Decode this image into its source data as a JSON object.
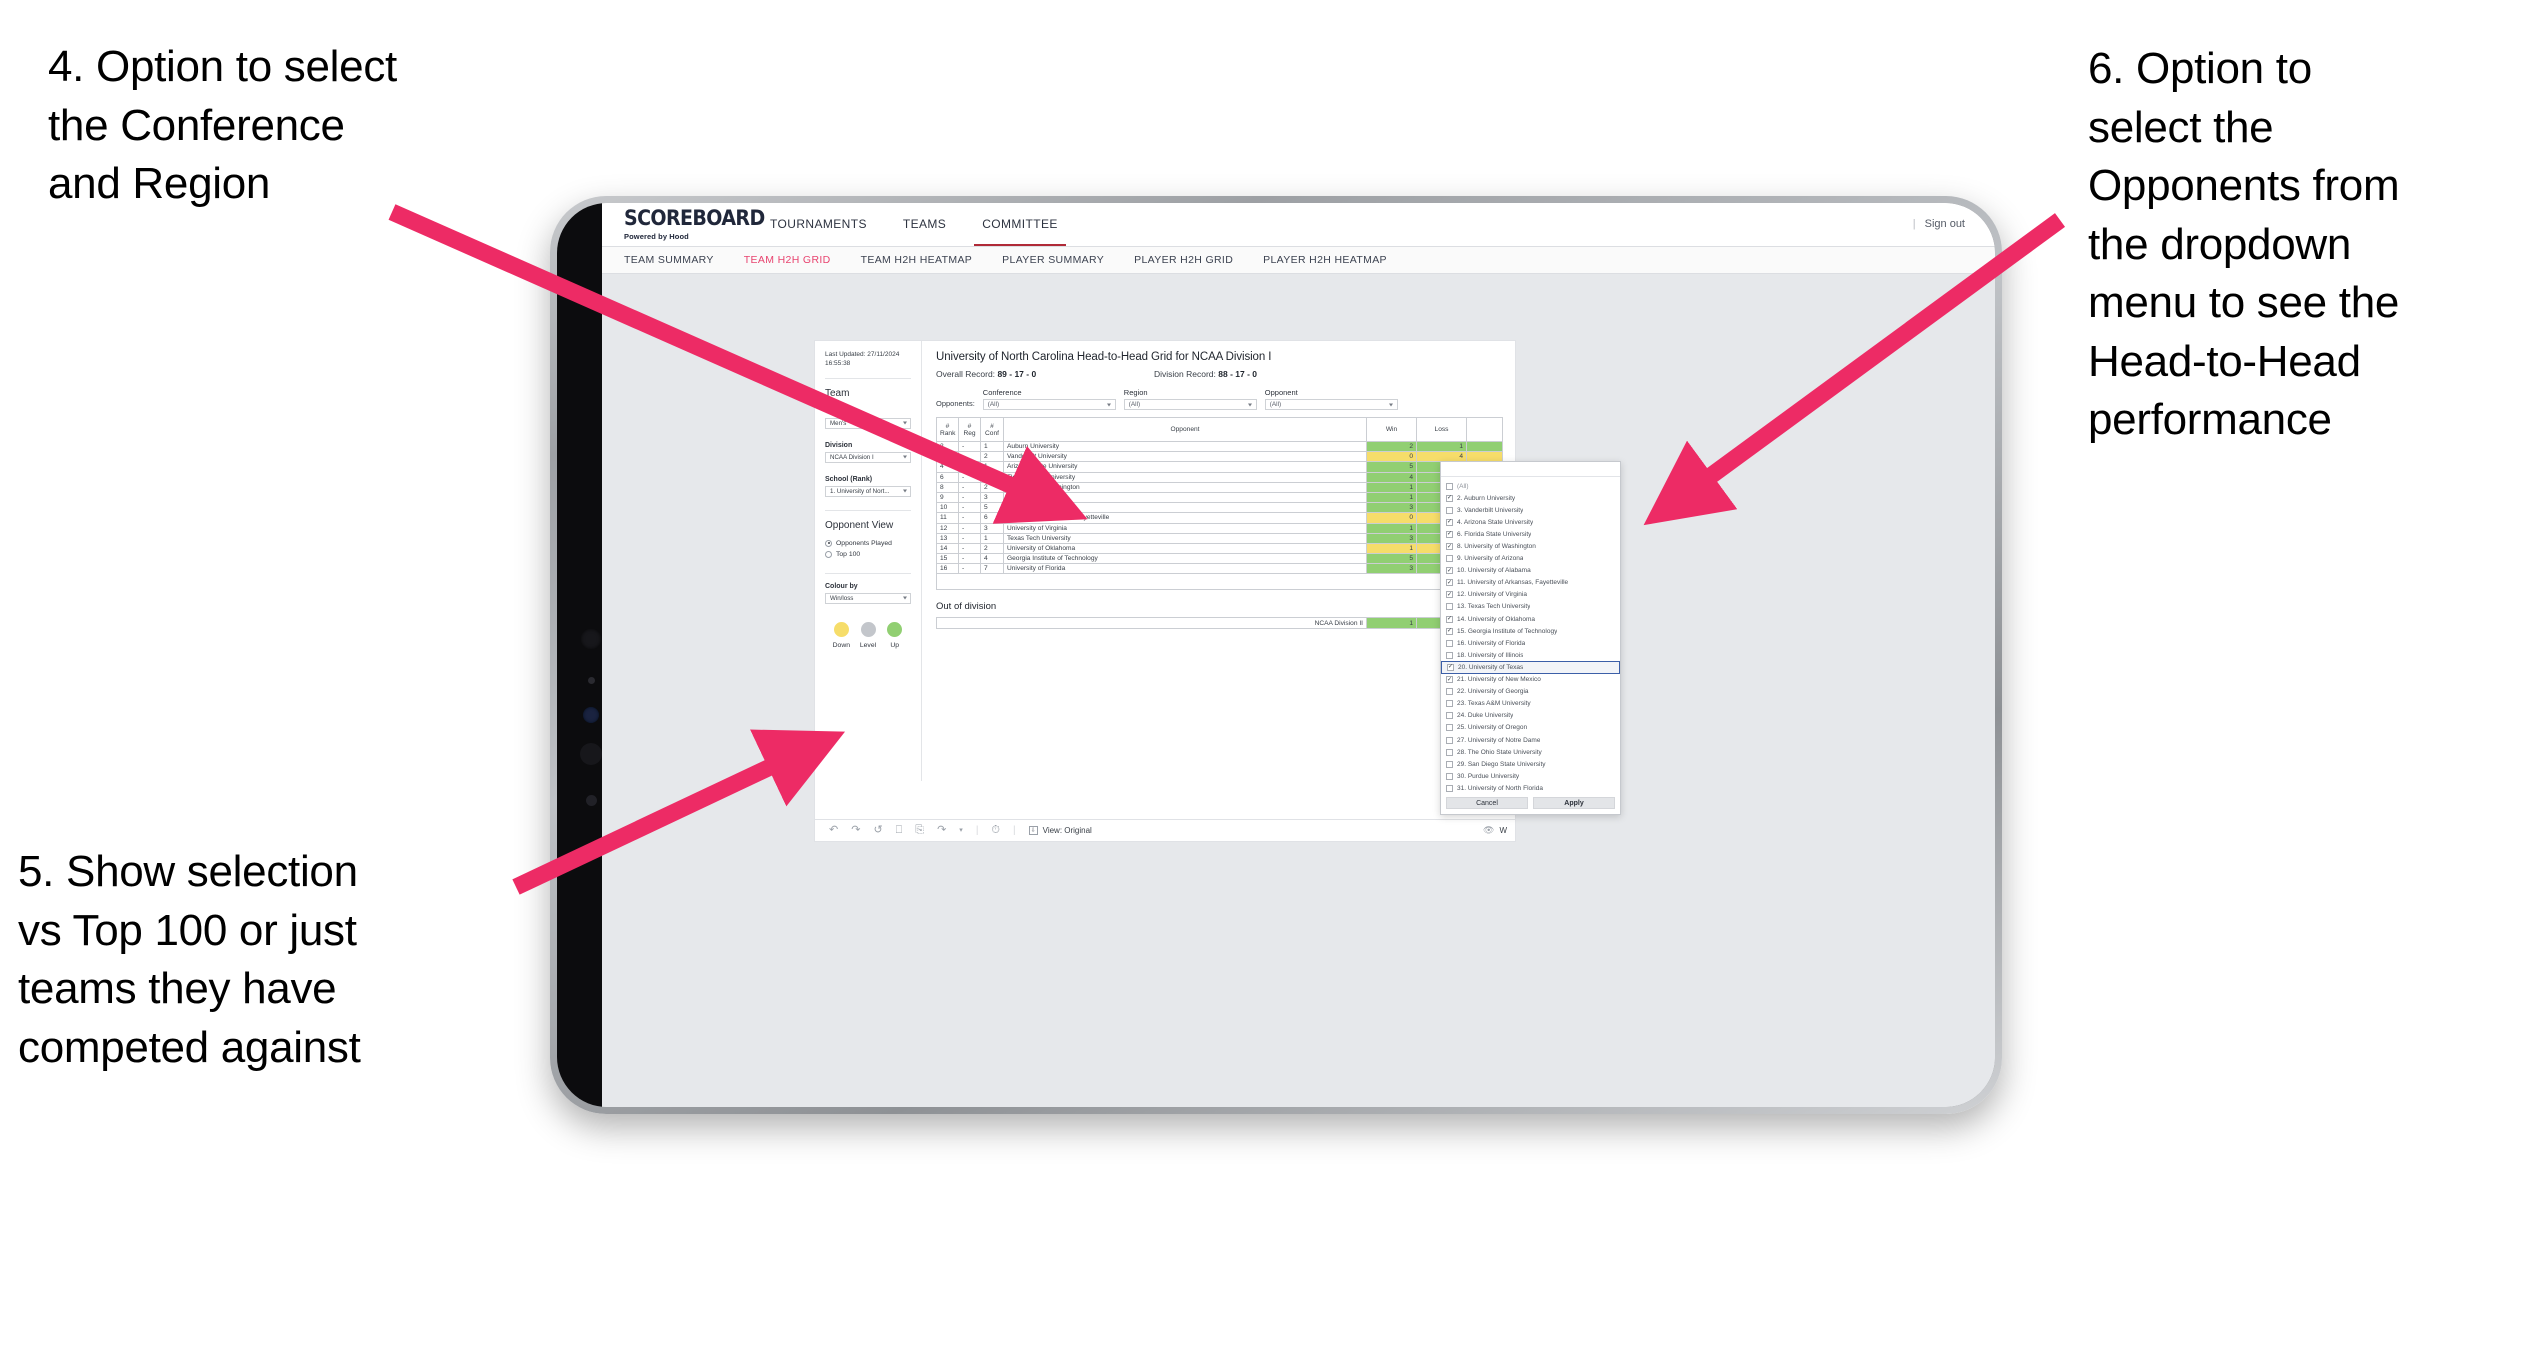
{
  "annotations": [
    {
      "id": "a4",
      "text": "4. Option to select\nthe Conference\nand Region"
    },
    {
      "id": "a5",
      "text": "5. Show selection\nvs Top 100 or just\nteams they have\ncompeted against"
    },
    {
      "id": "a6",
      "text": "6. Option to\nselect the\nOpponents from\nthe dropdown\nmenu to see the\nHead-to-Head\nperformance"
    }
  ],
  "colors": {
    "arrow": "#ED2B65",
    "accent_red": "#b02a37",
    "accent_pink": "#e8436f",
    "up_green": "#91cf72",
    "down_yellow": "#f6dd6a",
    "level_grey": "#c3c6cb"
  },
  "app": {
    "logo": {
      "main": "SCOREBOARD",
      "sub": "Powered by Hood"
    },
    "topnav": [
      {
        "label": "TOURNAMENTS",
        "active": false
      },
      {
        "label": "TEAMS",
        "active": false
      },
      {
        "label": "COMMITTEE",
        "active": true
      }
    ],
    "signout": {
      "divider": "|",
      "label": "Sign out"
    },
    "subnav": [
      {
        "label": "TEAM SUMMARY",
        "active": false
      },
      {
        "label": "TEAM H2H GRID",
        "active": true
      },
      {
        "label": "TEAM H2H HEATMAP",
        "active": false
      },
      {
        "label": "PLAYER SUMMARY",
        "active": false
      },
      {
        "label": "PLAYER H2H GRID",
        "active": false
      },
      {
        "label": "PLAYER H2H HEATMAP",
        "active": false
      }
    ]
  },
  "left_panel": {
    "last_updated": "Last Updated: 27/11/2024 16:55:38",
    "team_heading": "Team",
    "fields": [
      {
        "label": "Gender",
        "value": "Men's"
      },
      {
        "label": "Division",
        "value": "NCAA Division I"
      },
      {
        "label": "School (Rank)",
        "value": "1. University of Nort..."
      }
    ],
    "opponent_view": {
      "heading": "Opponent View",
      "options": [
        {
          "label": "Opponents Played",
          "selected": true
        },
        {
          "label": "Top 100",
          "selected": false
        }
      ]
    },
    "colour_by": {
      "label": "Colour by",
      "value": "Win/loss"
    },
    "legend": [
      {
        "label": "Down",
        "color": "#f6dd6a"
      },
      {
        "label": "Level",
        "color": "#c3c6cb"
      },
      {
        "label": "Up",
        "color": "#91cf72"
      }
    ]
  },
  "viz": {
    "title": "University of North Carolina Head-to-Head Grid for NCAA Division I",
    "overall_record_label": "Overall Record:",
    "overall_record_value": "89 - 17 - 0",
    "division_record_label": "Division Record:",
    "division_record_value": "88 - 17 - 0",
    "opponents_label": "Opponents:",
    "filters": [
      {
        "label": "Conference",
        "value": "(All)"
      },
      {
        "label": "Region",
        "value": "(All)"
      },
      {
        "label": "Opponent",
        "value": "(All)"
      }
    ],
    "out_of_division": {
      "title": "Out of division",
      "name": "NCAA Division II",
      "win": "1",
      "loss": "0",
      "state": "up"
    }
  },
  "chart_data": {
    "type": "table",
    "title": "University of North Carolina Head-to-Head Grid for NCAA Division I",
    "columns": [
      "# Rank",
      "# Reg",
      "# Conf",
      "Opponent",
      "Win",
      "Loss",
      ""
    ],
    "column_headers_split": [
      {
        "l1": "#",
        "l2": "Rank"
      },
      {
        "l1": "#",
        "l2": "Reg"
      },
      {
        "l1": "#",
        "l2": "Conf"
      },
      {
        "l1": "",
        "l2": "Opponent"
      },
      {
        "l1": "",
        "l2": "Win"
      },
      {
        "l1": "",
        "l2": "Loss"
      },
      {
        "l1": "",
        "l2": ""
      }
    ],
    "rows": [
      {
        "rank": "2",
        "reg": "-",
        "conf": "1",
        "opponent": "Auburn University",
        "win": "2",
        "loss": "1",
        "state": "up"
      },
      {
        "rank": "3",
        "reg": "-",
        "conf": "2",
        "opponent": "Vanderbilt University",
        "win": "0",
        "loss": "4",
        "state": "down"
      },
      {
        "rank": "4",
        "reg": "-",
        "conf": "1",
        "opponent": "Arizona State University",
        "win": "5",
        "loss": "1",
        "state": "up"
      },
      {
        "rank": "6",
        "reg": "-",
        "conf": "2",
        "opponent": "Florida State University",
        "win": "4",
        "loss": "2",
        "state": "up"
      },
      {
        "rank": "8",
        "reg": "-",
        "conf": "2",
        "opponent": "University of Washington",
        "win": "1",
        "loss": "0",
        "state": "up"
      },
      {
        "rank": "9",
        "reg": "-",
        "conf": "3",
        "opponent": "University of Arizona",
        "win": "1",
        "loss": "0",
        "state": "up"
      },
      {
        "rank": "10",
        "reg": "-",
        "conf": "5",
        "opponent": "University of Alabama",
        "win": "3",
        "loss": "0",
        "state": "up"
      },
      {
        "rank": "11",
        "reg": "-",
        "conf": "6",
        "opponent": "University of Arkansas, Fayetteville",
        "win": "0",
        "loss": "1",
        "state": "down"
      },
      {
        "rank": "12",
        "reg": "-",
        "conf": "3",
        "opponent": "University of Virginia",
        "win": "1",
        "loss": "0",
        "state": "up"
      },
      {
        "rank": "13",
        "reg": "-",
        "conf": "1",
        "opponent": "Texas Tech University",
        "win": "3",
        "loss": "0",
        "state": "up"
      },
      {
        "rank": "14",
        "reg": "-",
        "conf": "2",
        "opponent": "University of Oklahoma",
        "win": "1",
        "loss": "2",
        "state": "down"
      },
      {
        "rank": "15",
        "reg": "-",
        "conf": "4",
        "opponent": "Georgia Institute of Technology",
        "win": "5",
        "loss": "0",
        "state": "up"
      },
      {
        "rank": "16",
        "reg": "-",
        "conf": "7",
        "opponent": "University of Florida",
        "win": "3",
        "loss": "1",
        "state": "up"
      }
    ]
  },
  "opponent_dropdown": {
    "items": [
      {
        "label": "(All)",
        "checked": false,
        "muted": true,
        "selected": false
      },
      {
        "label": "2. Auburn University",
        "checked": true,
        "muted": false,
        "selected": false
      },
      {
        "label": "3. Vanderbilt University",
        "checked": false,
        "muted": false,
        "selected": false
      },
      {
        "label": "4. Arizona State University",
        "checked": true,
        "muted": false,
        "selected": false
      },
      {
        "label": "6. Florida State University",
        "checked": true,
        "muted": false,
        "selected": false
      },
      {
        "label": "8. University of Washington",
        "checked": true,
        "muted": false,
        "selected": false
      },
      {
        "label": "9. University of Arizona",
        "checked": false,
        "muted": false,
        "selected": false
      },
      {
        "label": "10. University of Alabama",
        "checked": true,
        "muted": false,
        "selected": false
      },
      {
        "label": "11. University of Arkansas, Fayetteville",
        "checked": true,
        "muted": false,
        "selected": false
      },
      {
        "label": "12. University of Virginia",
        "checked": true,
        "muted": false,
        "selected": false
      },
      {
        "label": "13. Texas Tech University",
        "checked": false,
        "muted": false,
        "selected": false
      },
      {
        "label": "14. University of Oklahoma",
        "checked": true,
        "muted": false,
        "selected": false
      },
      {
        "label": "15. Georgia Institute of Technology",
        "checked": true,
        "muted": false,
        "selected": false
      },
      {
        "label": "16. University of Florida",
        "checked": false,
        "muted": false,
        "selected": false
      },
      {
        "label": "18. University of Illinois",
        "checked": false,
        "muted": false,
        "selected": false
      },
      {
        "label": "20. University of Texas",
        "checked": true,
        "muted": false,
        "selected": true
      },
      {
        "label": "21. University of New Mexico",
        "checked": true,
        "muted": false,
        "selected": false
      },
      {
        "label": "22. University of Georgia",
        "checked": false,
        "muted": false,
        "selected": false
      },
      {
        "label": "23. Texas A&M University",
        "checked": false,
        "muted": false,
        "selected": false
      },
      {
        "label": "24. Duke University",
        "checked": false,
        "muted": false,
        "selected": false
      },
      {
        "label": "25. University of Oregon",
        "checked": false,
        "muted": false,
        "selected": false
      },
      {
        "label": "27. University of Notre Dame",
        "checked": false,
        "muted": false,
        "selected": false
      },
      {
        "label": "28. The Ohio State University",
        "checked": false,
        "muted": false,
        "selected": false
      },
      {
        "label": "29. San Diego State University",
        "checked": false,
        "muted": false,
        "selected": false
      },
      {
        "label": "30. Purdue University",
        "checked": false,
        "muted": false,
        "selected": false
      },
      {
        "label": "31. University of North Florida",
        "checked": false,
        "muted": false,
        "selected": false
      }
    ],
    "cancel_label": "Cancel",
    "apply_label": "Apply"
  },
  "toolbar": {
    "icons": [
      "undo-icon",
      "redo-icon",
      "revert-icon",
      "pause-refresh-icon",
      "refresh-icon",
      "share-icon",
      "chevron-down-icon",
      "history-icon"
    ],
    "view_label": "View: Original",
    "right_label": "W"
  }
}
